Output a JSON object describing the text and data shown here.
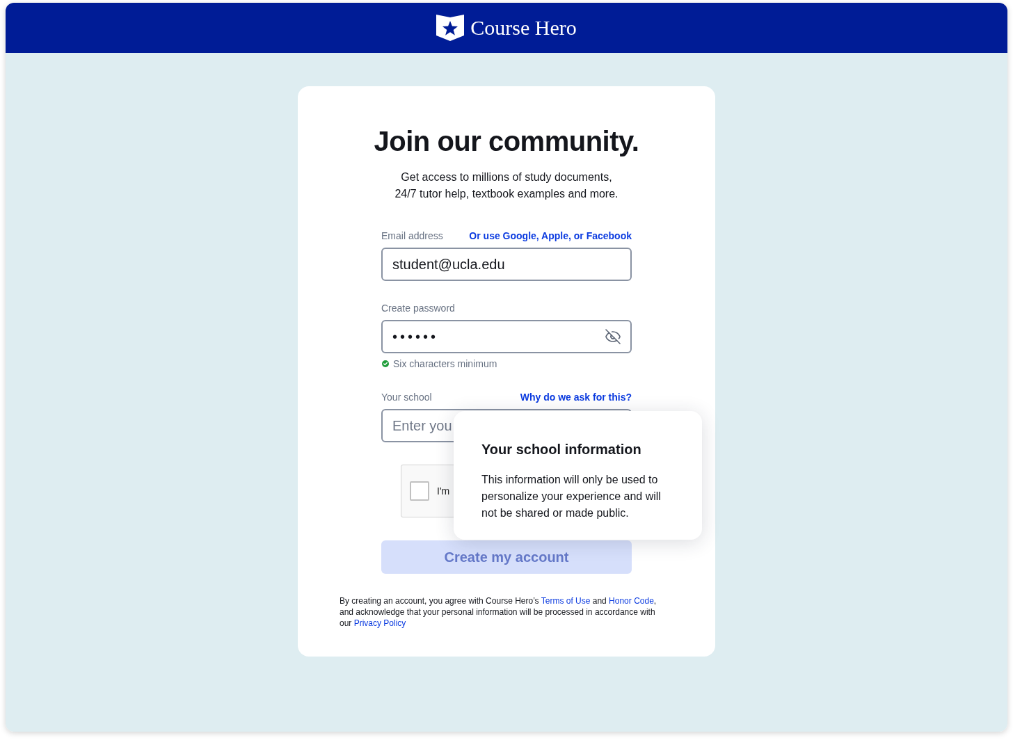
{
  "header": {
    "logo_text": "Course Hero"
  },
  "card": {
    "title": "Join our community.",
    "subtitle_lines": [
      "Get access to millions of study documents,",
      "24/7 tutor help, textbook examples and more."
    ]
  },
  "email": {
    "label": "Email address",
    "link": "Or use Google, Apple, or Facebook",
    "value": "student@ucla.edu"
  },
  "password": {
    "label": "Create password",
    "value": "••••••",
    "masked": true,
    "hint": {
      "text": "Six characters minimum",
      "met": true
    }
  },
  "school": {
    "label": "Your school",
    "link": "Why do we ask for this?",
    "placeholder": "Enter you",
    "tooltip": {
      "title": "Your school information",
      "text": "This information will only be used to personalize your experience and will not be shared or made public."
    }
  },
  "captcha": {
    "label": "I'm",
    "checked": false
  },
  "submit": {
    "label": "Create my account",
    "disabled": true
  },
  "legal": {
    "parts": [
      {
        "kind": "text",
        "text": "By creating an account, you agree with Course Hero’s "
      },
      {
        "kind": "link",
        "text": "Terms of Use"
      },
      {
        "kind": "text",
        "text": " and "
      },
      {
        "kind": "link",
        "text": "Honor Code"
      },
      {
        "kind": "text",
        "text": ", and acknowledge that your personal information will be processed in accordance with our "
      },
      {
        "kind": "link",
        "text": "Privacy Policy"
      }
    ]
  }
}
